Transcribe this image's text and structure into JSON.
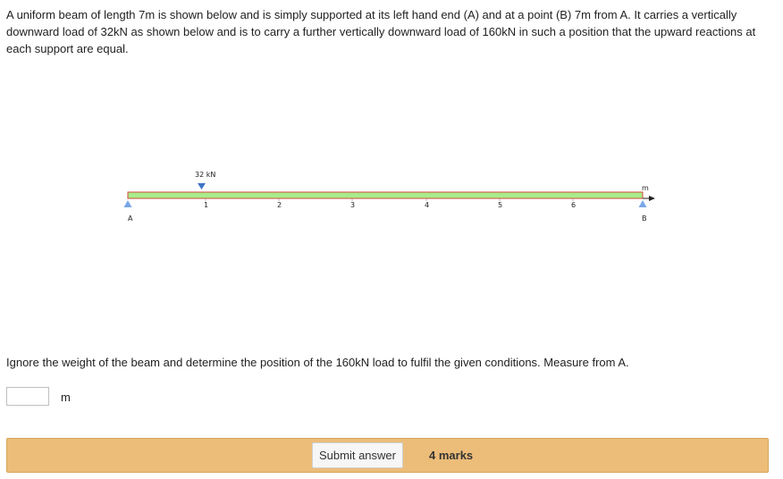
{
  "question": {
    "text": "A uniform beam of length 7m is shown below and is simply supported at its left hand end (A) and at a point (B) 7m from A. It carries a vertically downward load of 32kN as shown below and is to carry a further vertically downward load of 160kN in such a position that the upward reactions at each support are equal."
  },
  "diagram": {
    "load_label": "32 kN",
    "unit_label": "m",
    "support_a_label": "A",
    "support_b_label": "B",
    "tick_labels": [
      "1",
      "2",
      "3",
      "4",
      "5",
      "6"
    ],
    "load_position_m": 1,
    "beam_length_m": 7,
    "beam_color": "#a8ec8a",
    "support_color": "#7aa6e8",
    "load_arrow_color": "#3f74c6"
  },
  "instruction": {
    "text": "Ignore the weight of the beam and determine the position of the 160kN load to fulfil the given conditions. Measure from A."
  },
  "answer": {
    "value": "",
    "unit": "m"
  },
  "submit": {
    "button_label": "Submit answer",
    "marks_label": "4 marks",
    "bar_color": "#ecbd79"
  }
}
